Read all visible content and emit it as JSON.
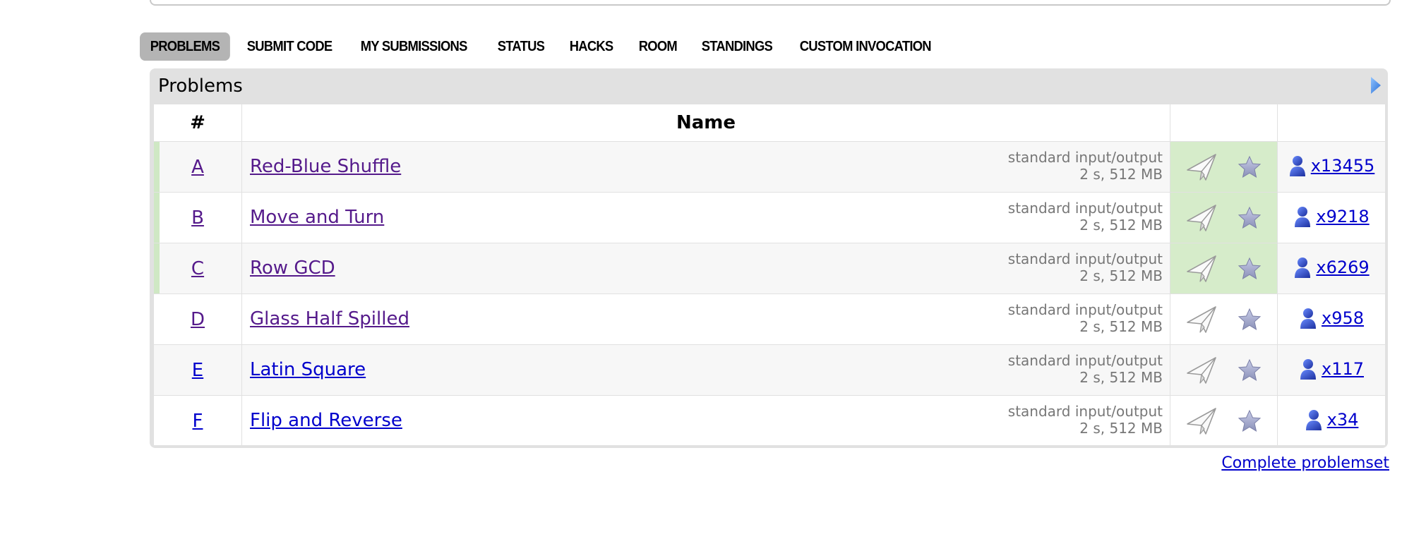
{
  "tabs": [
    {
      "label": "PROBLEMS",
      "active": true
    },
    {
      "label": "SUBMIT CODE",
      "active": false
    },
    {
      "label": "MY SUBMISSIONS",
      "active": false
    },
    {
      "label": "STATUS",
      "active": false
    },
    {
      "label": "HACKS",
      "active": false
    },
    {
      "label": "ROOM",
      "active": false
    },
    {
      "label": "STANDINGS",
      "active": false
    },
    {
      "label": "CUSTOM INVOCATION",
      "active": false
    }
  ],
  "panel": {
    "title": "Problems",
    "columns": {
      "index": "#",
      "name": "Name"
    }
  },
  "problems": [
    {
      "index": "A",
      "name": "Red-Blue Shuffle",
      "io": "standard input/output",
      "limits": "2 s, 512 MB",
      "solved": "x13455",
      "accepted": true,
      "visited": true
    },
    {
      "index": "B",
      "name": "Move and Turn",
      "io": "standard input/output",
      "limits": "2 s, 512 MB",
      "solved": "x9218",
      "accepted": true,
      "visited": true
    },
    {
      "index": "C",
      "name": "Row GCD",
      "io": "standard input/output",
      "limits": "2 s, 512 MB",
      "solved": "x6269",
      "accepted": true,
      "visited": true
    },
    {
      "index": "D",
      "name": "Glass Half Spilled",
      "io": "standard input/output",
      "limits": "2 s, 512 MB",
      "solved": "x958",
      "accepted": false,
      "visited": true
    },
    {
      "index": "E",
      "name": "Latin Square",
      "io": "standard input/output",
      "limits": "2 s, 512 MB",
      "solved": "x117",
      "accepted": false,
      "visited": false
    },
    {
      "index": "F",
      "name": "Flip and Reverse",
      "io": "standard input/output",
      "limits": "2 s, 512 MB",
      "solved": "x34",
      "accepted": false,
      "visited": false
    }
  ],
  "icons": {
    "submit": "send-icon",
    "favourite": "star-icon",
    "solvers": "user-icon",
    "collapse": "arrow-right-icon"
  },
  "footer": {
    "complete_link": "Complete problemset"
  },
  "colors": {
    "accepted_bg": "#d6ecca",
    "link": "#0000cc",
    "visited_link": "#551a8b"
  }
}
